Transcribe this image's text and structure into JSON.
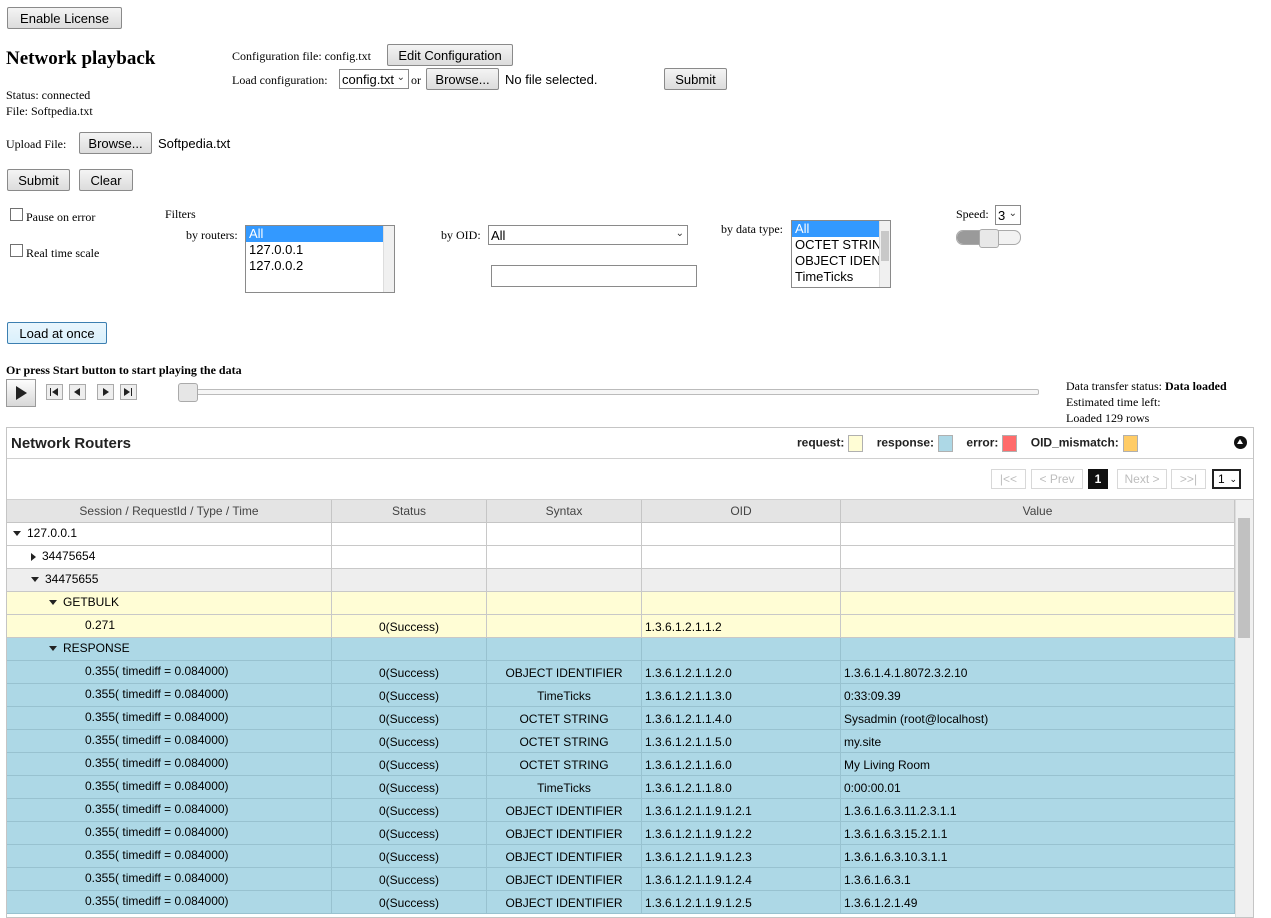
{
  "license_button": "Enable License",
  "page_title": "Network playback",
  "status": "Status: connected",
  "file": "File: Softpedia.txt",
  "config": {
    "file_label": "Configuration file: config.txt",
    "edit_button": "Edit Configuration",
    "load_label": "Load configuration:",
    "load_select": "config.txt",
    "or": "or",
    "browse_button": "Browse...",
    "no_file": "No file selected.",
    "submit_button": "Submit"
  },
  "upload": {
    "label": "Upload File:",
    "browse_button": "Browse...",
    "filename": "Softpedia.txt",
    "submit_button": "Submit",
    "clear_button": "Clear"
  },
  "options": {
    "pause_on_error": "Pause on error",
    "real_time_scale": "Real time scale"
  },
  "filters": {
    "title": "Filters",
    "routers_label": "by routers:",
    "routers_options": [
      "All",
      "127.0.0.1",
      "127.0.0.2"
    ],
    "oid_label": "by OID:",
    "oid_select": "All",
    "datatype_label": "by data type:",
    "datatype_options": [
      "All",
      "OCTET STRING",
      "OBJECT IDENTIFIER",
      "TimeTicks"
    ],
    "speed_label": "Speed:",
    "speed_value": "3"
  },
  "load_at_once_button": "Load at once",
  "start_hint": "Or press Start button to start playing the data",
  "transfer": {
    "status_label": "Data transfer status:",
    "status_value": "Data loaded",
    "time_left": "Estimated time left:",
    "loaded_rows": "Loaded 129 rows"
  },
  "grid": {
    "title": "Network Routers",
    "legend": {
      "request": "request:",
      "response": "response:",
      "error": "error:",
      "oid_mismatch": "OID_mismatch:"
    },
    "colors": {
      "request": "#fffdd5",
      "response": "#add8e6",
      "error": "#ff6b6b",
      "oid_mismatch": "#ffcc66"
    },
    "pager": {
      "first": "|<<",
      "prev": "< Prev",
      "current": "1",
      "next": "Next >",
      "last": ">>|",
      "page_select": "1"
    },
    "columns": [
      "Session / RequestId / Type / Time",
      "Status",
      "Syntax",
      "OID",
      "Value"
    ],
    "rows": [
      {
        "kind": "white",
        "indent": 0,
        "toggle": "down",
        "cells": [
          "127.0.0.1",
          "",
          "",
          "",
          ""
        ]
      },
      {
        "kind": "white",
        "indent": 1,
        "toggle": "right",
        "cells": [
          "34475654",
          "",
          "",
          "",
          ""
        ]
      },
      {
        "kind": "gray",
        "indent": 1,
        "toggle": "down",
        "cells": [
          "34475655",
          "",
          "",
          "",
          ""
        ]
      },
      {
        "kind": "request",
        "indent": 2,
        "toggle": "down",
        "cells": [
          "GETBULK",
          "",
          "",
          "",
          ""
        ]
      },
      {
        "kind": "request",
        "indent": 4,
        "toggle": "",
        "cells": [
          "0.271",
          "0(Success)",
          "",
          "1.3.6.1.2.1.1.2",
          ""
        ]
      },
      {
        "kind": "response",
        "indent": 2,
        "toggle": "down",
        "cells": [
          "RESPONSE",
          "",
          "",
          "",
          ""
        ]
      },
      {
        "kind": "response",
        "indent": 4,
        "toggle": "",
        "cells": [
          "0.355( timediff = 0.084000)",
          "0(Success)",
          "OBJECT IDENTIFIER",
          "1.3.6.1.2.1.1.2.0",
          "1.3.6.1.4.1.8072.3.2.10"
        ]
      },
      {
        "kind": "response",
        "indent": 4,
        "toggle": "",
        "cells": [
          "0.355( timediff = 0.084000)",
          "0(Success)",
          "TimeTicks",
          "1.3.6.1.2.1.1.3.0",
          "0:33:09.39"
        ]
      },
      {
        "kind": "response",
        "indent": 4,
        "toggle": "",
        "cells": [
          "0.355( timediff = 0.084000)",
          "0(Success)",
          "OCTET STRING",
          "1.3.6.1.2.1.1.4.0",
          "Sysadmin (root@localhost)"
        ]
      },
      {
        "kind": "response",
        "indent": 4,
        "toggle": "",
        "cells": [
          "0.355( timediff = 0.084000)",
          "0(Success)",
          "OCTET STRING",
          "1.3.6.1.2.1.1.5.0",
          "my.site"
        ]
      },
      {
        "kind": "response",
        "indent": 4,
        "toggle": "",
        "cells": [
          "0.355( timediff = 0.084000)",
          "0(Success)",
          "OCTET STRING",
          "1.3.6.1.2.1.1.6.0",
          "My Living Room"
        ]
      },
      {
        "kind": "response",
        "indent": 4,
        "toggle": "",
        "cells": [
          "0.355( timediff = 0.084000)",
          "0(Success)",
          "TimeTicks",
          "1.3.6.1.2.1.1.8.0",
          "0:00:00.01"
        ]
      },
      {
        "kind": "response",
        "indent": 4,
        "toggle": "",
        "cells": [
          "0.355( timediff = 0.084000)",
          "0(Success)",
          "OBJECT IDENTIFIER",
          "1.3.6.1.2.1.1.9.1.2.1",
          "1.3.6.1.6.3.11.2.3.1.1"
        ]
      },
      {
        "kind": "response",
        "indent": 4,
        "toggle": "",
        "cells": [
          "0.355( timediff = 0.084000)",
          "0(Success)",
          "OBJECT IDENTIFIER",
          "1.3.6.1.2.1.1.9.1.2.2",
          "1.3.6.1.6.3.15.2.1.1"
        ]
      },
      {
        "kind": "response",
        "indent": 4,
        "toggle": "",
        "cells": [
          "0.355( timediff = 0.084000)",
          "0(Success)",
          "OBJECT IDENTIFIER",
          "1.3.6.1.2.1.1.9.1.2.3",
          "1.3.6.1.6.3.10.3.1.1"
        ]
      },
      {
        "kind": "response",
        "indent": 4,
        "toggle": "",
        "cells": [
          "0.355( timediff = 0.084000)",
          "0(Success)",
          "OBJECT IDENTIFIER",
          "1.3.6.1.2.1.1.9.1.2.4",
          "1.3.6.1.6.3.1"
        ]
      },
      {
        "kind": "response",
        "indent": 4,
        "toggle": "",
        "cells": [
          "0.355( timediff = 0.084000)",
          "0(Success)",
          "OBJECT IDENTIFIER",
          "1.3.6.1.2.1.1.9.1.2.5",
          "1.3.6.1.2.1.49"
        ]
      }
    ]
  }
}
